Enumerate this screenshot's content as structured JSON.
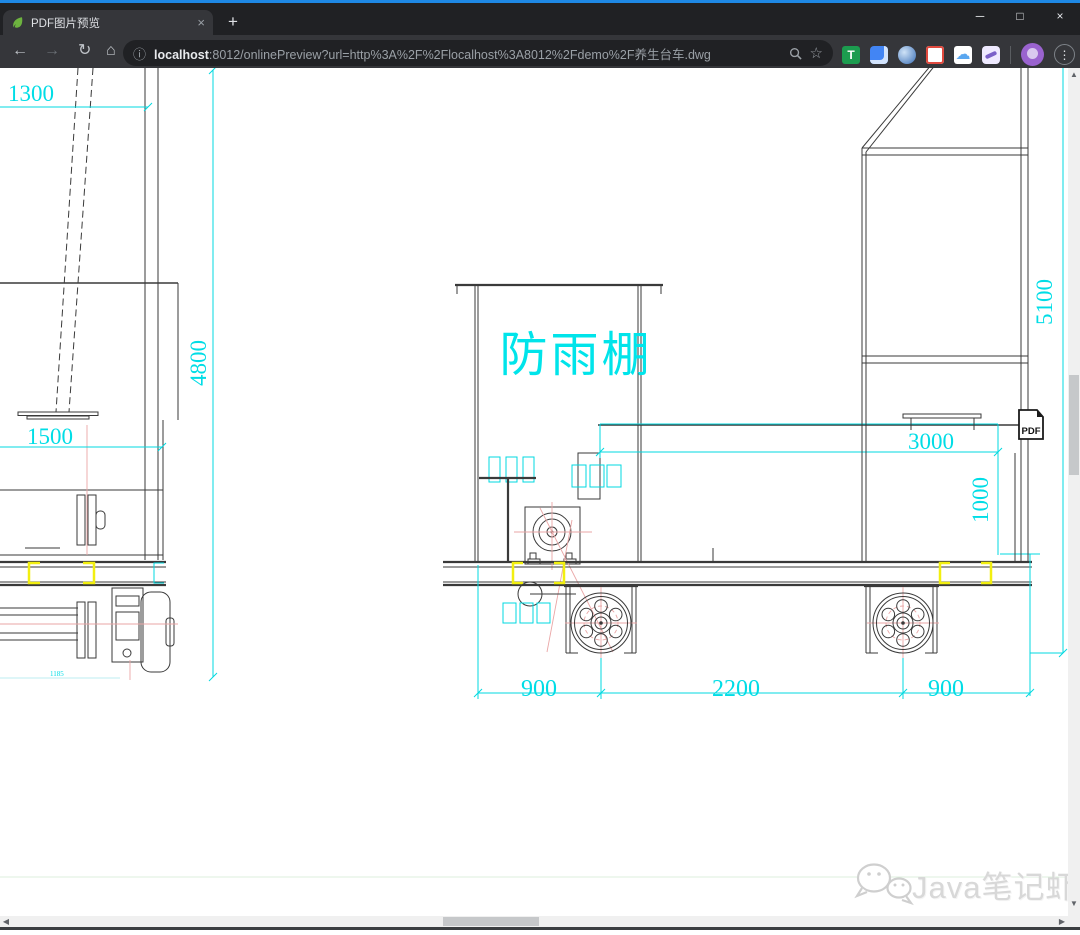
{
  "browser": {
    "window_controls": {
      "minimize": "─",
      "maximize": "□",
      "close": "×"
    },
    "tab": {
      "title": "PDF图片预览",
      "close": "×"
    },
    "new_tab": "+",
    "nav": {
      "back": "←",
      "forward": "→",
      "reload": "↻",
      "home": "⌂"
    },
    "address": {
      "info_icon": "ⓘ",
      "host": "localhost",
      "rest": ":8012/onlinePreview?url=http%3A%2F%2Flocalhost%3A8012%2Fdemo%2F养生台车.dwg",
      "bookmark_star": "☆"
    },
    "extensions": [
      {
        "name": "tampermonkey",
        "color": "#1c9c4f",
        "glyph": "T"
      },
      {
        "name": "translate",
        "color": "#4285f4",
        "glyph": ""
      },
      {
        "name": "blue-sphere",
        "color": "#3b6fb6",
        "glyph": ""
      },
      {
        "name": "red-app",
        "color": "#e04a3f",
        "glyph": ""
      },
      {
        "name": "cloud",
        "color": "#5aa7f0",
        "glyph": "☁"
      },
      {
        "name": "swallow",
        "color": "#7b61c9",
        "glyph": ""
      }
    ],
    "menu_dots": "⋮"
  },
  "drawing": {
    "shelter_label": "防雨棚",
    "pdf_badge": "PDF",
    "dims": {
      "d1300": "1300",
      "d4800": "4800",
      "d1500": "1500",
      "d5100": "5100",
      "d3000": "3000",
      "d1000": "1000",
      "d900_left": "900",
      "d2200": "2200",
      "d900_right": "900",
      "d_small": "1185"
    },
    "colors": {
      "dimension": "#00dde6",
      "line": "#3a3a3a",
      "bracket": "#f2ef10",
      "centerline": "#eaa6a6"
    }
  },
  "watermark": {
    "text": "Java笔记虾"
  },
  "scroll": {
    "up": "▲",
    "down": "▼",
    "left": "◀",
    "right": "▶"
  }
}
